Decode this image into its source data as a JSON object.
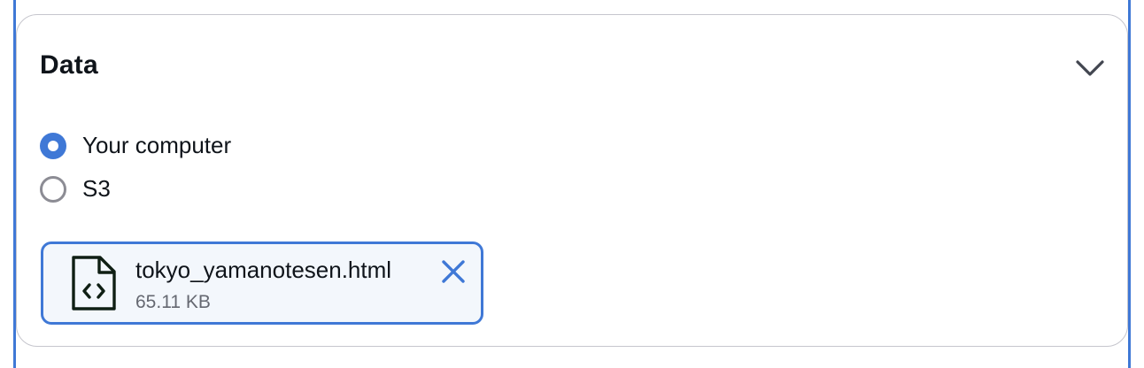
{
  "panel": {
    "title": "Data",
    "collapse_icon": "chevron-down-icon"
  },
  "source_options": [
    {
      "label": "Your computer",
      "selected": true
    },
    {
      "label": "S3",
      "selected": false
    }
  ],
  "uploaded_file": {
    "name": "tokyo_yamanotesen.html",
    "size": "65.11 KB",
    "file_icon": "html-file-icon",
    "remove_icon": "close-icon"
  },
  "colors": {
    "accent": "#3f78d6",
    "text": "#0f141a",
    "secondary_text": "#656871",
    "border": "#c6c6cd",
    "token_background": "#f3f7fc"
  }
}
